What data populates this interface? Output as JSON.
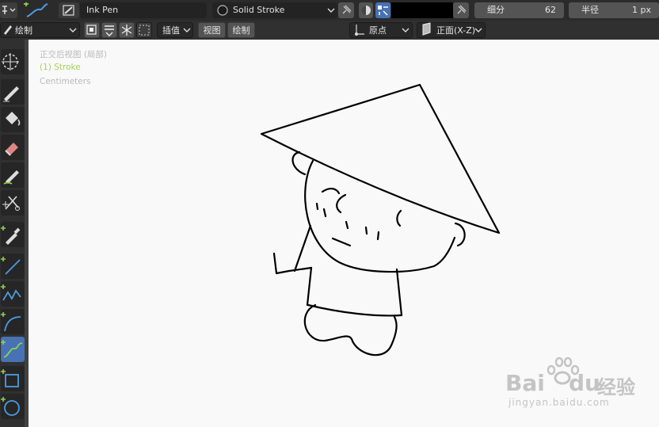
{
  "header": {
    "brush_name": "Ink Pen",
    "material_name": "Solid Stroke",
    "subdivision_label": "细分",
    "subdivision_value": "62",
    "radius_label": "半径",
    "radius_value": "1 px"
  },
  "toolbar2": {
    "mode": "绘制",
    "interpolate": "插值",
    "view": "视图",
    "draw": "绘制",
    "origin": "原点",
    "front": "正面(X-Z)"
  },
  "viewport": {
    "view_name": "正交后视图 (局部)",
    "object_name": "(1) Stroke",
    "units": "Centimeters"
  },
  "watermark": {
    "brand_latin": "Bai",
    "brand_du": "du",
    "brand_cn": "经验",
    "url": "jingyan.baidu.com"
  },
  "colors": {
    "accent": "#4772b3",
    "header_bg": "#2b2b2b",
    "viewport_bg": "#f9f9f9",
    "stroke": "#000000",
    "object_label": "#a6d25a"
  }
}
